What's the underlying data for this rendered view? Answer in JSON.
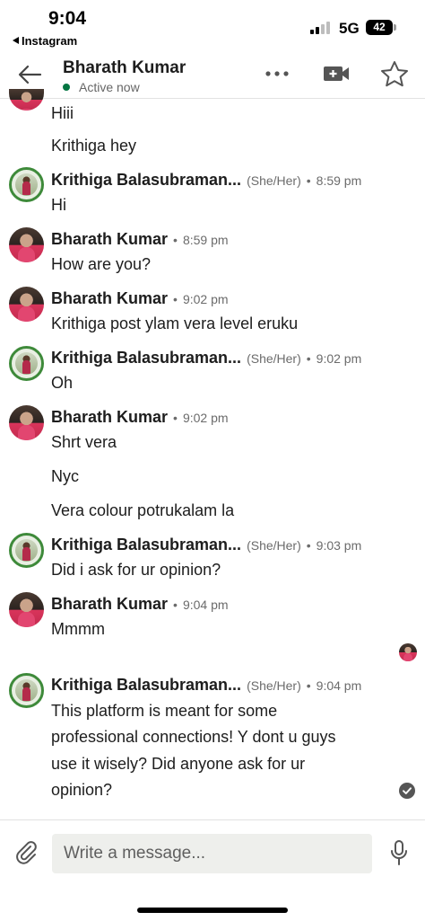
{
  "status_bar": {
    "time": "9:04",
    "back_app": "Instagram",
    "network": "5G",
    "battery": "42"
  },
  "header": {
    "contact_name": "Bharath Kumar",
    "presence": "Active now",
    "presence_color": "#057642",
    "icons": [
      "back-arrow-icon",
      "more-icon",
      "video-call-icon",
      "star-icon"
    ]
  },
  "messages": [
    {
      "text": "Hiii"
    },
    {
      "text": "Krithiga hey"
    },
    {
      "name": "Krithiga Balasubraman...",
      "pronouns": "(She/Her)",
      "time": "8:59 pm",
      "text": "Hi"
    },
    {
      "name": "Bharath Kumar",
      "time": "8:59 pm",
      "text": "How are you?"
    },
    {
      "name": "Bharath Kumar",
      "time": "9:02 pm",
      "text": "Krithiga post ylam vera level eruku"
    },
    {
      "name": "Krithiga Balasubraman...",
      "pronouns": "(She/Her)",
      "time": "9:02 pm",
      "text": "Oh"
    },
    {
      "name": "Bharath Kumar",
      "time": "9:02 pm",
      "text": "Shrt vera"
    },
    {
      "text": "Nyc"
    },
    {
      "text": "Vera colour potrukalam la"
    },
    {
      "name": "Krithiga Balasubraman...",
      "pronouns": "(She/Her)",
      "time": "9:03 pm",
      "text": "Did i ask for ur opinion?"
    },
    {
      "name": "Bharath Kumar",
      "time": "9:04 pm",
      "text": "Mmmm"
    },
    {
      "name": "Krithiga Balasubraman...",
      "pronouns": "(She/Her)",
      "time": "9:04 pm",
      "lines": [
        "This platform is meant for some",
        "professional connections! Y dont u guys",
        "use it wisely? Did anyone ask for ur",
        "opinion?"
      ]
    }
  ],
  "separator": "•",
  "composer": {
    "placeholder": "Write a message...",
    "icons": [
      "attachment-icon",
      "microphone-icon"
    ]
  }
}
